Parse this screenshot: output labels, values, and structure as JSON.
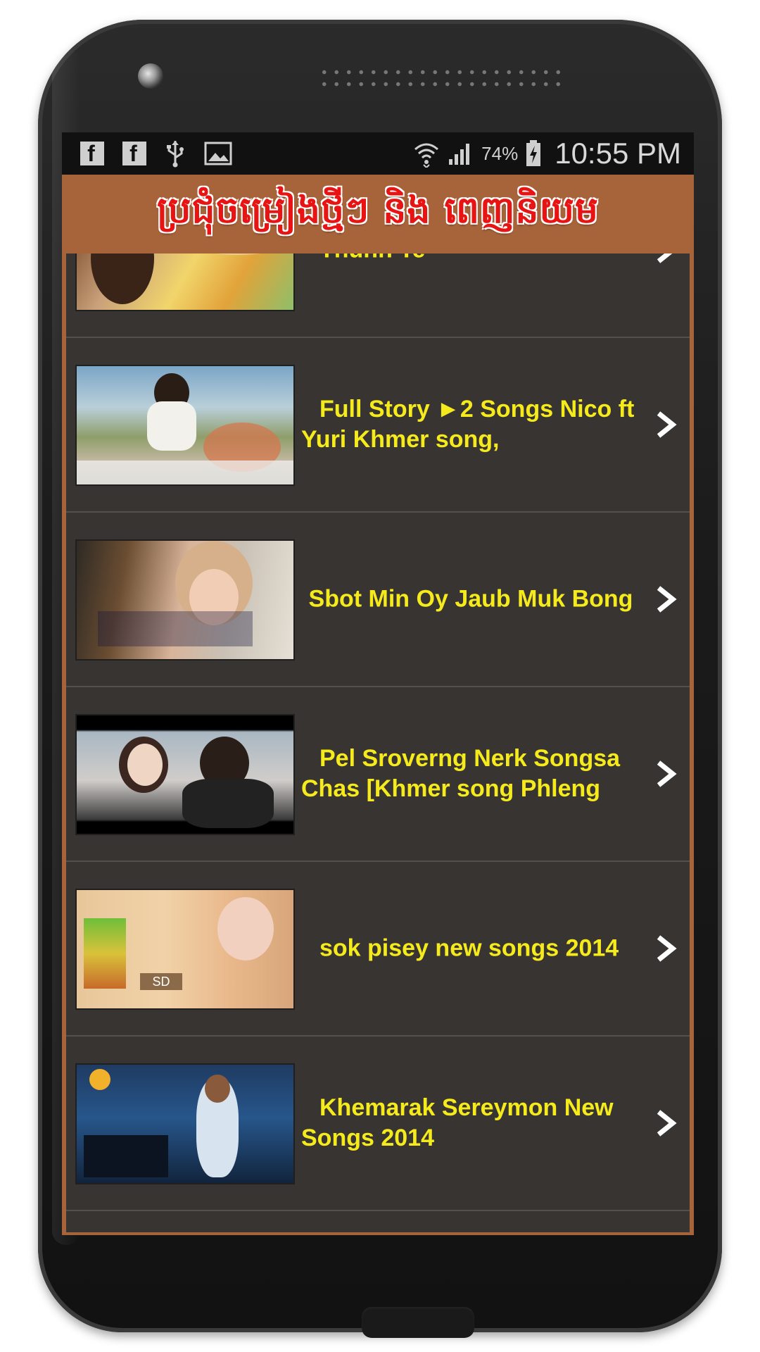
{
  "app": {
    "header_title": "ប្រជុំចម្រៀងថ្មីៗ និង ពេញនិយម"
  },
  "status_bar": {
    "battery_percent": "74%",
    "time": "10:55 PM",
    "left_icons": [
      "facebook-icon",
      "facebook-icon",
      "usb-icon",
      "image-icon"
    ],
    "right_icons": [
      "wifi-icon",
      "signal-icon",
      "battery-charging-icon"
    ]
  },
  "list": {
    "items": [
      {
        "title": "Thunh Te",
        "thumb": "singer-promo-thumbnail"
      },
      {
        "title": "Full Story ►2 Songs Nico ft Yuri Khmer song,",
        "thumb": "music-video-thumbnail"
      },
      {
        "title": "Sbot Min Oy Jaub Muk Bong",
        "thumb": "karaoke-thumbnail"
      },
      {
        "title": "Pel Sroverng Nerk Songsa Chas [Khmer song Phleng",
        "thumb": "couple-video-thumbnail"
      },
      {
        "title": "sok pisey new songs 2014",
        "thumb": "album-cover-thumbnail"
      },
      {
        "title": "Khemarak Sereymon New Songs 2014",
        "thumb": "concert-thumbnail"
      }
    ]
  },
  "colors": {
    "header_bg": "#a7643a",
    "title_red": "#e81414",
    "list_bg": "#383431",
    "item_text": "#f5ea1b"
  }
}
